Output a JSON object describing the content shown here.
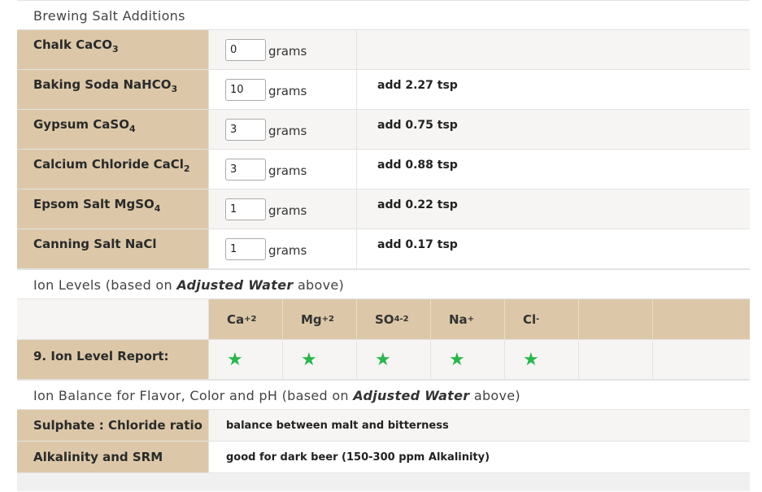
{
  "salts": {
    "title": "Brewing Salt Additions",
    "unit": "grams",
    "rows": [
      {
        "name": "Chalk CaCO",
        "sub": "3",
        "value": "0",
        "add": ""
      },
      {
        "name": "Baking Soda NaHCO",
        "sub": "3",
        "value": "10",
        "add": "add 2.27 tsp"
      },
      {
        "name": "Gypsum CaSO",
        "sub": "4",
        "value": "3",
        "add": "add 0.75 tsp"
      },
      {
        "name": "Calcium Chloride CaCl",
        "sub": "2",
        "value": "3",
        "add": "add 0.88 tsp"
      },
      {
        "name": "Epsom Salt MgSO",
        "sub": "4",
        "value": "1",
        "add": "add 0.22 tsp"
      },
      {
        "name": "Canning Salt NaCl",
        "sub": "",
        "value": "1",
        "add": "add 0.17 tsp"
      }
    ]
  },
  "ions": {
    "title_pre": "Ion Levels (based on ",
    "title_em": "Adjusted Water",
    "title_post": " above)",
    "headers": [
      {
        "base": "Ca",
        "sup": "+2",
        "sub": ""
      },
      {
        "base": "Mg",
        "sup": "+2",
        "sub": ""
      },
      {
        "base": "SO",
        "sup": "-2",
        "sub": "4"
      },
      {
        "base": "Na",
        "sup": "+",
        "sub": ""
      },
      {
        "base": "Cl",
        "sup": "-",
        "sub": ""
      }
    ],
    "report_label": "9. Ion Level Report:",
    "status_icon": "star-icon",
    "star_color": "#27b84a",
    "star": "★"
  },
  "balance": {
    "title_pre": "Ion Balance for Flavor, Color and pH (based on ",
    "title_em": "Adjusted Water",
    "title_post": " above)",
    "rows": [
      {
        "label": "Sulphate : Chloride ratio",
        "value": "balance between malt and bitterness"
      },
      {
        "label": "Alkalinity and SRM",
        "value": "good for dark beer (150-300 ppm Alkalinity)"
      }
    ]
  }
}
